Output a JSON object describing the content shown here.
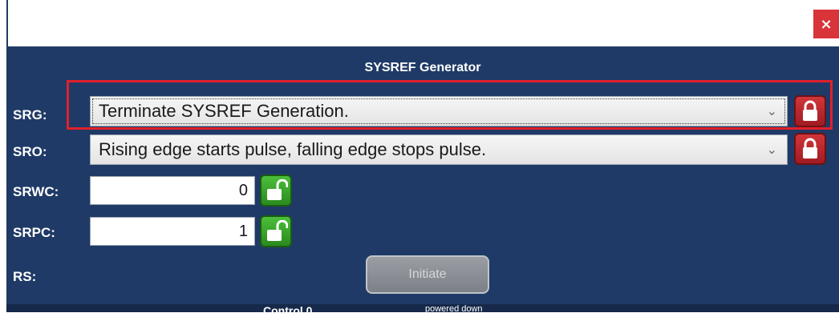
{
  "window": {
    "close_label": "×"
  },
  "panel": {
    "title": "SYSREF Generator"
  },
  "rows": {
    "srg": {
      "label": "SRG:",
      "value": "Terminate SYSREF Generation."
    },
    "sro": {
      "label": "SRO:",
      "value": "Rising edge starts pulse, falling edge stops pulse."
    },
    "srwc": {
      "label": "SRWC:",
      "value": "0"
    },
    "srpc": {
      "label": "SRPC:",
      "value": "1"
    },
    "rs": {
      "label": "RS:"
    }
  },
  "buttons": {
    "initiate": "Initiate"
  },
  "footer": {
    "partial_left": "Control 0",
    "partial_right": "powered down"
  },
  "icons": {
    "chevron": "chevron-down-icon",
    "locked": "lock-closed-icon",
    "unlocked": "lock-open-icon"
  },
  "colors": {
    "panel_bg": "#1f3a66",
    "close_bg": "#d9343a",
    "highlight": "#e0202a",
    "lock_locked": "#c0282e",
    "lock_unlocked": "#3aa52e"
  }
}
